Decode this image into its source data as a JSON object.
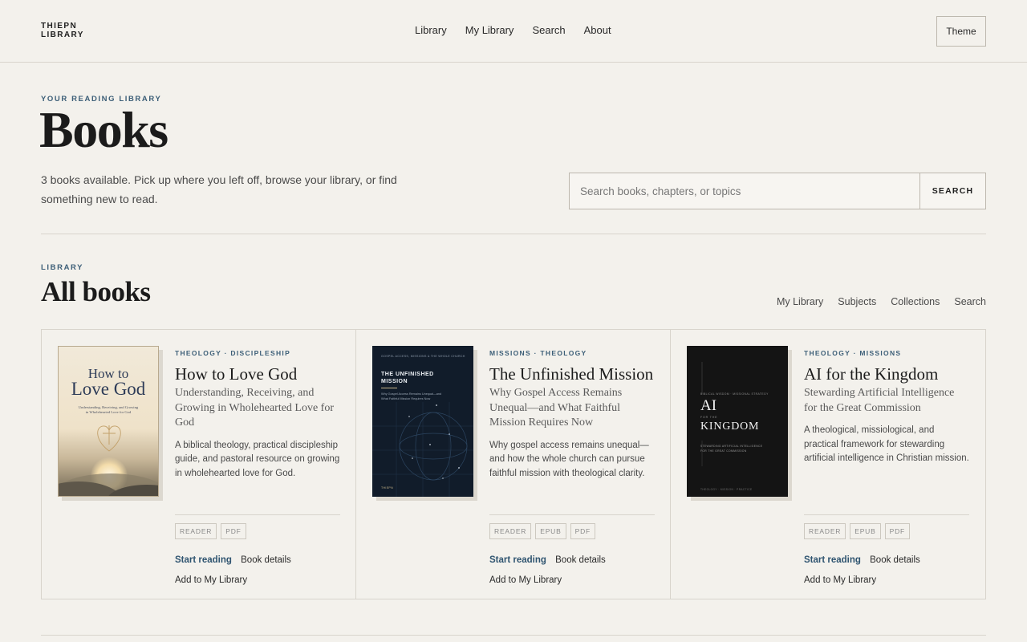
{
  "header": {
    "logo_line1": "THIEPN",
    "logo_line2": "LIBRARY",
    "nav": [
      "Library",
      "My Library",
      "Search",
      "About"
    ],
    "theme_label": "Theme"
  },
  "hero": {
    "eyebrow": "YOUR READING LIBRARY",
    "title": "Books",
    "description": "3 books available. Pick up where you left off, browse your library, or find something new to read.",
    "search_placeholder": "Search books, chapters, or topics",
    "search_button": "SEARCH"
  },
  "library": {
    "eyebrow": "LIBRARY",
    "title": "All books",
    "subnav": [
      "My Library",
      "Subjects",
      "Collections",
      "Search"
    ]
  },
  "books": [
    {
      "subjects": "THEOLOGY · DISCIPLESHIP",
      "title": "How to Love God",
      "subtitle": "Understanding, Receiving, and Growing in Wholehearted Love for God",
      "description": "A biblical theology, practical discipleship guide, and pastoral resource on growing in wholehearted love for God.",
      "formats": [
        "READER",
        "PDF"
      ],
      "start_label": "Start reading",
      "details_label": "Book details",
      "add_label": "Add to My Library",
      "cover": {
        "title_line1": "How to",
        "title_line2": "Love God",
        "subtitle_line1": "Understanding, Receiving, and Growing",
        "subtitle_line2": "in Wholehearted Love for God"
      }
    },
    {
      "subjects": "MISSIONS · THEOLOGY",
      "title": "The Unfinished Mission",
      "subtitle": "Why Gospel Access Remains Unequal—and What Faithful Mission Requires Now",
      "description": "Why gospel access remains unequal—and how the whole church can pursue faithful mission with theological clarity.",
      "formats": [
        "READER",
        "EPUB",
        "PDF"
      ],
      "start_label": "Start reading",
      "details_label": "Book details",
      "add_label": "Add to My Library",
      "cover": {
        "top_text": "GOSPEL ACCESS, MISSIONS & THE WHOLE CHURCH",
        "title_line1": "THE UNFINISHED",
        "title_line2": "MISSION",
        "subtitle": "Why Gospel Access Remains Unequal—and What Faithful Mission Requires Now",
        "author": "THIEPN"
      }
    },
    {
      "subjects": "THEOLOGY · MISSIONS",
      "title": "AI for the Kingdom",
      "subtitle": "Stewarding Artificial Intelligence for the Great Commission",
      "description": "A theological, missiological, and practical framework for stewarding artificial intelligence in Christian mission.",
      "formats": [
        "READER",
        "EPUB",
        "PDF"
      ],
      "start_label": "Start reading",
      "details_label": "Book details",
      "add_label": "Add to My Library",
      "cover": {
        "top_text": "BIBLICAL WISDOM · MISSIONAL STRATEGY",
        "title_line1": "AI",
        "for_the": "FOR THE",
        "title_line2": "KINGDOM",
        "subtitle_line1": "STEWARDING ARTIFICIAL INTELLIGENCE",
        "subtitle_line2": "FOR THE GREAT COMMISSION",
        "bottom_text": "THEOLOGY · MISSION · PRACTICE"
      }
    }
  ],
  "colors": {
    "background": "#f3f1ec",
    "accent": "#3d5f78",
    "border": "#d8d4cc"
  }
}
